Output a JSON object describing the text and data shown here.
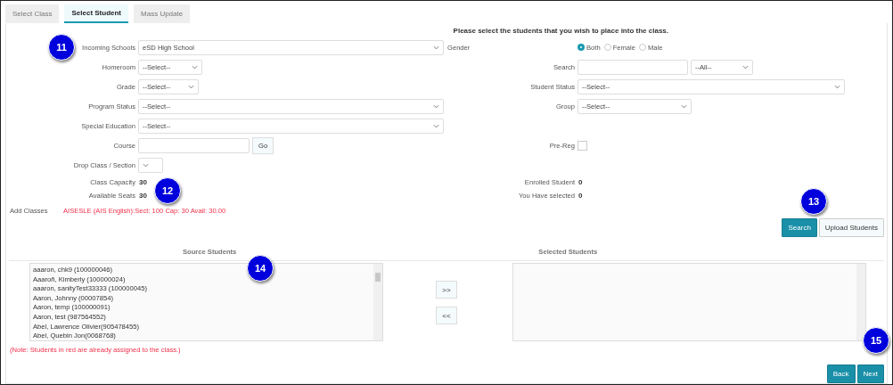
{
  "tabs": [
    {
      "label": "Select Class",
      "selected": false
    },
    {
      "label": "Select Student",
      "selected": true
    },
    {
      "label": "Mass Update",
      "selected": false
    }
  ],
  "instruction": "Please select the students that you wish to place into the class.",
  "form_rows": [
    {
      "left": {
        "label": "Incoming Schools",
        "kind": "select",
        "value": "eSD High School"
      },
      "right": {
        "label": "Gender",
        "kind": "radio",
        "options": [
          {
            "label": "Both",
            "selected": true
          },
          {
            "label": "Female",
            "selected": false
          },
          {
            "label": "Male",
            "selected": false
          }
        ]
      }
    },
    {
      "left": {
        "label": "Homeroom",
        "kind": "select",
        "value": "--Select--"
      },
      "right": {
        "label": "Search",
        "kind": "input-select",
        "value": "--All--"
      }
    },
    {
      "left": {
        "label": "Grade",
        "kind": "select",
        "value": "--Select--"
      },
      "right": {
        "label": "Student Status",
        "kind": "select",
        "value": "--Select--"
      }
    },
    {
      "left": {
        "label": "Program Status",
        "kind": "select",
        "value": "--Select--"
      },
      "right": {
        "label": "Group",
        "kind": "select",
        "value": "--Select--"
      }
    },
    {
      "left": {
        "label": "Special Education",
        "kind": "select",
        "value": "--Select--"
      }
    },
    {
      "left": {
        "label": "Course",
        "kind": "input-button",
        "button": "Go"
      },
      "right": {
        "label": "Pre-Reg",
        "kind": "checkbox",
        "checked": false
      }
    },
    {
      "left": {
        "label": "Drop Class / Section",
        "kind": "select"
      }
    }
  ],
  "stats": [
    {
      "left": {
        "label": "Class Capacity",
        "value": "30"
      },
      "right": {
        "label": "Enrolled Student",
        "value": "0"
      }
    },
    {
      "left": {
        "label": "Available Seats",
        "value": "30"
      },
      "right": {
        "label": "You Have selected",
        "value": "0"
      }
    }
  ],
  "add_classes": {
    "label": "Add Classes",
    "value": "AISESLE (AIS English):Sect: 100 Cap: 30 Avail: 30.00"
  },
  "action_buttons": [
    {
      "label": "Search",
      "kind": "primary"
    },
    {
      "label": "Upload Students",
      "kind": "secondary"
    }
  ],
  "source": {
    "title": "Source Students",
    "items": [
      "aaaron, chk9 (100000046)",
      "Aaaroñ, Kimberly (100000024)",
      "aaaron, sanityTest33333 (100000045)",
      "Aaron, Johnny (00007854)",
      "Aaron, temp (100000091)",
      "Aaron, test (987564552)",
      "Abel, Lawrence Olivier(905478455)",
      "Abel, Quebin Jon(0068768)"
    ]
  },
  "move_buttons": [
    ">>",
    "<<"
  ],
  "selected_list": {
    "title": "Selected Students"
  },
  "note": "(Note: Students in red are already assigned to the class.)",
  "nav_buttons": [
    {
      "label": "Back"
    },
    {
      "label": "Next"
    }
  ],
  "callouts": [
    "11",
    "12",
    "13",
    "14",
    "15"
  ]
}
